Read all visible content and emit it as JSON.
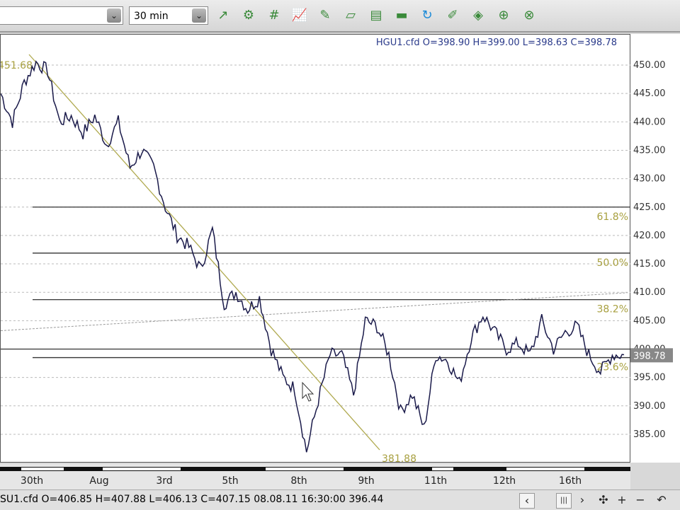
{
  "toolbar": {
    "symbol_value": "",
    "timeframe_value": "30 min",
    "icons": [
      "add-study-icon",
      "study-settings-icon",
      "grid-icon",
      "chart-type-icon",
      "draw-line-icon",
      "drawing-tools-icon",
      "page-icon",
      "print-icon",
      "refresh-icon",
      "edit-icon",
      "palette-icon",
      "add-indicator-icon",
      "indicator-settings-icon"
    ]
  },
  "chart": {
    "header": "HGU1.cfd O=398.90 H=399.00 L=398.63 C=398.78",
    "fib_labels": [
      "61.8%",
      "50.0%",
      "38.2%",
      "23.6%"
    ],
    "trend_start_label": "451.68",
    "trend_end_label": "381.88",
    "last_price_label": "398.78"
  },
  "chart_data": {
    "type": "line",
    "symbol": "HGU1.cfd",
    "ylim": [
      381,
      452
    ],
    "yticks": [
      "450.00",
      "445.00",
      "440.00",
      "435.00",
      "430.00",
      "425.00",
      "420.00",
      "415.00",
      "410.00",
      "405.00",
      "400.00",
      "395.00",
      "390.00",
      "385.00"
    ],
    "xticks": [
      "30th",
      "Aug",
      "3rd",
      "5th",
      "8th",
      "9th",
      "11th",
      "12th",
      "16th"
    ],
    "fib_levels": [
      425.0,
      416.9,
      408.7,
      398.5
    ],
    "series": [
      {
        "name": "price",
        "values": [
          445,
          440,
          447,
          450.5,
          449,
          440,
          441,
          438,
          441,
          436,
          440,
          432,
          435,
          432,
          425,
          420,
          418,
          414,
          421,
          408,
          410,
          407,
          409,
          400,
          395,
          393,
          382,
          391,
          399,
          399,
          392,
          405,
          404,
          399,
          389,
          392,
          386,
          399,
          398,
          394,
          402,
          406,
          403,
          400,
          401,
          399,
          405,
          400,
          403,
          404,
          399,
          396,
          399,
          399
        ]
      }
    ]
  },
  "status": {
    "text": "SU1.cfd O=406.85 H=407.88 L=406.13 C=407.15   08.08.11 16:30:00 396.44",
    "nav_left": "‹",
    "scroll_thumb": "|||",
    "nav_right": "›",
    "move": "✣",
    "zoom_in": "+",
    "zoom_out": "−",
    "reset": "↶"
  }
}
